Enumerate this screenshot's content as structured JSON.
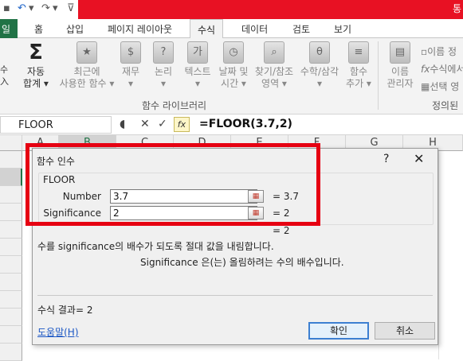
{
  "title_bar": {
    "right_text": "통"
  },
  "ribbon": {
    "file_tab_label": "일",
    "tabs": [
      "홈",
      "삽입",
      "페이지 레이아웃",
      "수식",
      "데이터",
      "검토",
      "보기"
    ],
    "active_tab": "수식",
    "autosum": {
      "line1": "자동",
      "line2": "합계 ▾"
    },
    "recent": {
      "line1": "최근에",
      "line2": "사용한 함수 ▾"
    },
    "financial": {
      "line1": "재무",
      "line2": "▾"
    },
    "logical": {
      "line1": "논리",
      "line2": "▾"
    },
    "text": {
      "line1": "텍스트",
      "line2": "▾"
    },
    "datetime": {
      "line1": "날짜 및",
      "line2": "시간 ▾"
    },
    "lookup": {
      "line1": "찾기/참조",
      "line2": "영역 ▾"
    },
    "math": {
      "line1": "수학/삼각",
      "line2": "▾"
    },
    "more": {
      "line1": "함수",
      "line2": "추가 ▾"
    },
    "name_manager": {
      "line1": "이름",
      "line2": "관리자"
    },
    "name_define": "이름 정",
    "use_in_formula": "수식에서",
    "create_from_selection": "선택 영",
    "group_function_library": "함수 라이브러리",
    "group_defined_names": "정의된"
  },
  "formula_bar": {
    "name_box": "FLOOR",
    "fx_label": "fx",
    "formula": "=FLOOR(3.7,2)"
  },
  "sheet": {
    "columns": [
      "A",
      "B",
      "C",
      "D",
      "E",
      "F",
      "G",
      "H"
    ],
    "selected_column": "B"
  },
  "dialog": {
    "title": "함수 인수",
    "help_glyph": "?",
    "close_glyph": "✕",
    "function_name": "FLOOR",
    "args": [
      {
        "label": "Number",
        "value": "3.7",
        "result": "=  3.7"
      },
      {
        "label": "Significance",
        "value": "2",
        "result": "=  2"
      }
    ],
    "total_result": "=  2",
    "description": "수를 significance의 배수가 되도록 절대 값을 내림합니다.",
    "arg_description": "Significance  은(는) 올림하려는 수의 배수입니다.",
    "formula_result": "수식 결과=  2",
    "help_link": "도움말(H)",
    "ok_label": "확인",
    "cancel_label": "취소"
  }
}
